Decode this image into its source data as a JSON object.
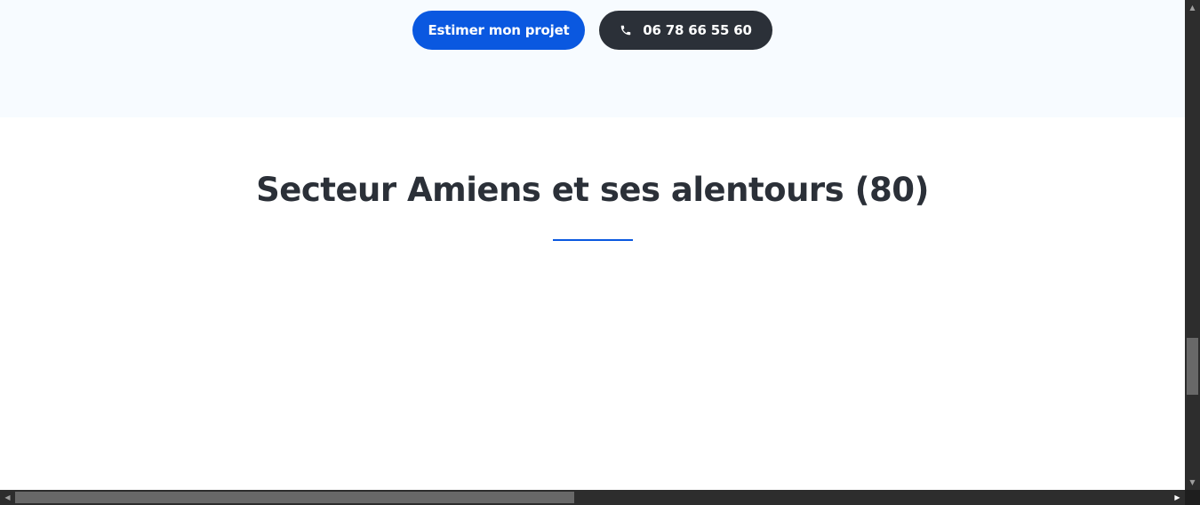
{
  "cta": {
    "estimate_label": "Estimer mon projet",
    "phone_label": "06 78 66 55 60",
    "phone_icon": "phone-icon"
  },
  "section": {
    "title": "Secteur Amiens et ses alentours (80)"
  },
  "colors": {
    "primary": "#0a58e0",
    "dark": "#2b3038",
    "band_background": "#f7fbff"
  },
  "scrollbars": {
    "vertical_icon_up": "▲",
    "vertical_icon_down": "▼",
    "horizontal_icon_left": "◀",
    "horizontal_icon_right": "▶"
  }
}
